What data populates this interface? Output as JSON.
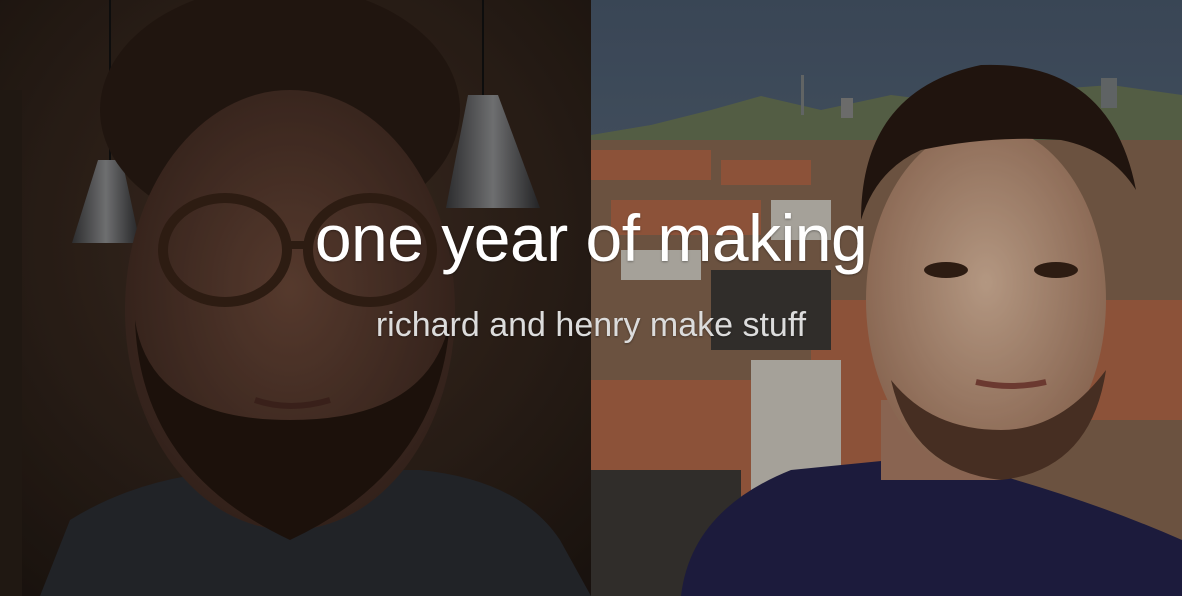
{
  "hero": {
    "title": "one year of making",
    "subtitle": "richard and henry make stuff"
  },
  "colors": {
    "title": "#ffffff",
    "subtitle": "#dcdcdc",
    "overlay": "rgba(0,0,0,0.22)"
  }
}
